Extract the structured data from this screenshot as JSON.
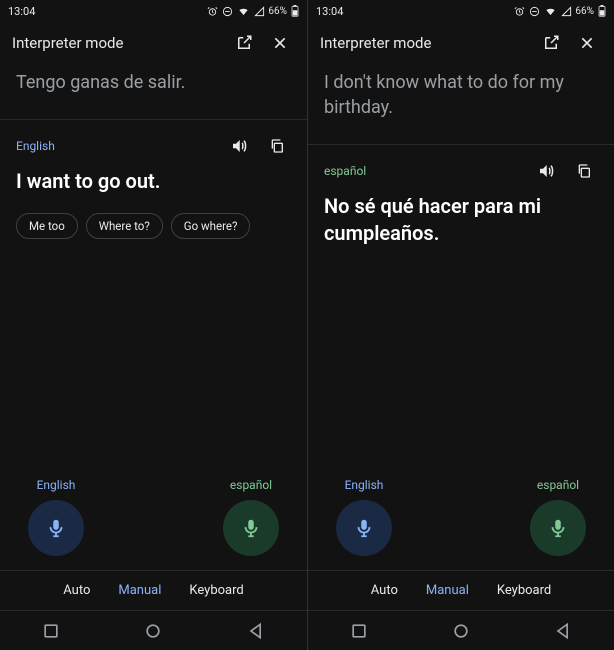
{
  "status": {
    "time": "13:04",
    "battery": "66%"
  },
  "left": {
    "header_title": "Interpreter mode",
    "source_text": "Tengo ganas de salir.",
    "trans_lang": "English",
    "trans_lang_class": "lang-en",
    "translation": "I want to go out.",
    "chips": [
      "Me too",
      "Where to?",
      "Go where?"
    ],
    "mic_left_lang": "English",
    "mic_right_lang": "español",
    "modes": {
      "auto": "Auto",
      "manual": "Manual",
      "keyboard": "Keyboard",
      "active": "manual"
    }
  },
  "right": {
    "header_title": "Interpreter mode",
    "source_text": "I don't know what to do for my birthday.",
    "trans_lang": "español",
    "trans_lang_class": "lang-es",
    "translation": "No sé qué hacer para mi cumpleaños.",
    "chips": [],
    "mic_left_lang": "English",
    "mic_right_lang": "español",
    "modes": {
      "auto": "Auto",
      "manual": "Manual",
      "keyboard": "Keyboard",
      "active": "manual"
    }
  }
}
